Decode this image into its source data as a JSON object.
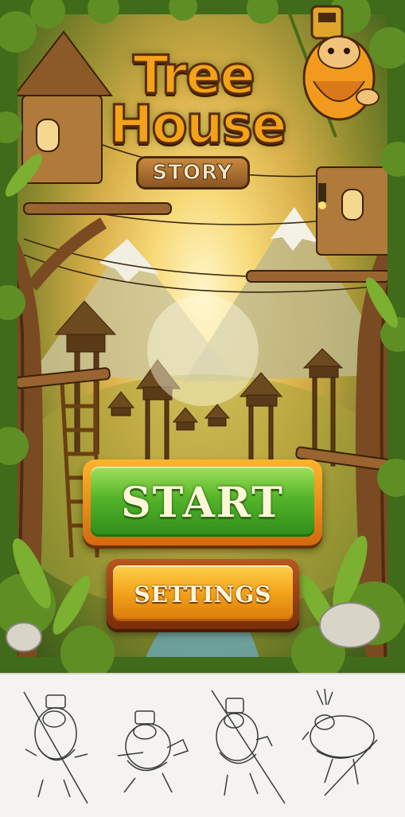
{
  "game": {
    "logo": {
      "line1": "Tree",
      "line2": "House",
      "line3": "STORY"
    },
    "menu": {
      "start_label": "START",
      "settings_label": "SETTINGS"
    }
  },
  "concept_sketches": [
    "character-sketch-1",
    "character-sketch-2",
    "character-sketch-3",
    "character-sketch-4"
  ],
  "colors": {
    "start_green": "#4fb025",
    "settings_orange": "#f2a21a",
    "logo_orange": "#f3a21a",
    "foliage": "#3f6b1a"
  }
}
